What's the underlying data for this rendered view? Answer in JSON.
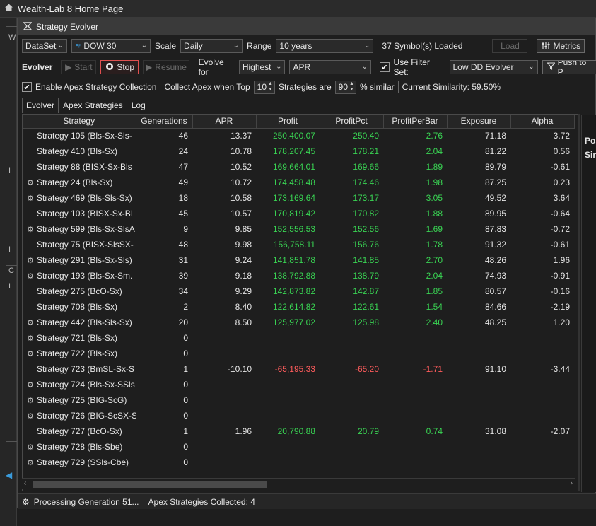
{
  "app": {
    "title": "Wealth-Lab 8 Home Page"
  },
  "window": {
    "title": "Strategy Evolver"
  },
  "toolbar1": {
    "dataset": "DataSet",
    "symbolset": "DOW 30",
    "scale_label": "Scale",
    "scale_value": "Daily",
    "range_label": "Range",
    "range_value": "10 years",
    "symbols_loaded": "37 Symbol(s) Loaded",
    "load": "Load",
    "metrics": "Metrics"
  },
  "toolbar2": {
    "evolver_label": "Evolver",
    "start": "Start",
    "stop": "Stop",
    "resume": "Resume",
    "evolve_for_label": "Evolve for",
    "evolve_direction": "Highest",
    "evolve_metric": "APR",
    "use_filter_label": "Use Filter Set:",
    "filter_set": "Low DD Evolver",
    "push_to": "Push to P"
  },
  "toolbar3": {
    "enable_apex": "Enable Apex Strategy Collection",
    "collect_apex": "Collect Apex when Top",
    "top_value": "10",
    "strategies_are": "Strategies are",
    "similar_value": "90",
    "similar_suffix": "% similar",
    "current_similarity": "Current Similarity: 59.50%"
  },
  "tabs": [
    "Evolver",
    "Apex Strategies",
    "Log"
  ],
  "grid": {
    "headers": [
      "Strategy",
      "Generations",
      "APR",
      "Profit",
      "ProfitPct",
      "ProfitPerBar",
      "Exposure",
      "Alpha"
    ],
    "rows": [
      {
        "busy": false,
        "strategy": "Strategy 105 (Bls-Sx-Sls-",
        "gen": "46",
        "apr": "13.37",
        "profit": "250,400.07",
        "pct": "250.40",
        "ppb": "2.76",
        "exp": "71.18",
        "alpha": "3.72",
        "neg": false
      },
      {
        "busy": false,
        "strategy": "Strategy 410 (Bls-Sx)",
        "gen": "24",
        "apr": "10.78",
        "profit": "178,207.45",
        "pct": "178.21",
        "ppb": "2.04",
        "exp": "81.22",
        "alpha": "0.56",
        "neg": false
      },
      {
        "busy": false,
        "strategy": "Strategy 88 (BISX-Sx-Bls",
        "gen": "47",
        "apr": "10.52",
        "profit": "169,664.01",
        "pct": "169.66",
        "ppb": "1.89",
        "exp": "89.79",
        "alpha": "-0.61",
        "neg": false
      },
      {
        "busy": true,
        "strategy": "Strategy 24 (Bls-Sx)",
        "gen": "49",
        "apr": "10.72",
        "profit": "174,458.48",
        "pct": "174.46",
        "ppb": "1.98",
        "exp": "87.25",
        "alpha": "0.23",
        "neg": false
      },
      {
        "busy": true,
        "strategy": "Strategy 469 (Bls-Sls-Sx)",
        "gen": "18",
        "apr": "10.58",
        "profit": "173,169.64",
        "pct": "173.17",
        "ppb": "3.05",
        "exp": "49.52",
        "alpha": "3.64",
        "neg": false
      },
      {
        "busy": false,
        "strategy": "Strategy 103 (BISX-Sx-BI",
        "gen": "45",
        "apr": "10.57",
        "profit": "170,819.42",
        "pct": "170.82",
        "ppb": "1.88",
        "exp": "89.95",
        "alpha": "-0.64",
        "neg": false
      },
      {
        "busy": true,
        "strategy": "Strategy 599 (Bls-Sx-SlsA",
        "gen": "9",
        "apr": "9.85",
        "profit": "152,556.53",
        "pct": "152.56",
        "ppb": "1.69",
        "exp": "87.83",
        "alpha": "-0.72",
        "neg": false
      },
      {
        "busy": false,
        "strategy": "Strategy 75 (BISX-SlsSX-",
        "gen": "48",
        "apr": "9.98",
        "profit": "156,758.11",
        "pct": "156.76",
        "ppb": "1.78",
        "exp": "91.32",
        "alpha": "-0.61",
        "neg": false
      },
      {
        "busy": true,
        "strategy": "Strategy 291 (Bls-Sx-Sls)",
        "gen": "31",
        "apr": "9.24",
        "profit": "141,851.78",
        "pct": "141.85",
        "ppb": "2.70",
        "exp": "48.26",
        "alpha": "1.96",
        "neg": false
      },
      {
        "busy": true,
        "strategy": "Strategy 193 (Bls-Sx-Sm.",
        "gen": "39",
        "apr": "9.18",
        "profit": "138,792.88",
        "pct": "138.79",
        "ppb": "2.04",
        "exp": "74.93",
        "alpha": "-0.91",
        "neg": false
      },
      {
        "busy": false,
        "strategy": "Strategy 275 (BcO-Sx)",
        "gen": "34",
        "apr": "9.29",
        "profit": "142,873.82",
        "pct": "142.87",
        "ppb": "1.85",
        "exp": "80.57",
        "alpha": "-0.16",
        "neg": false
      },
      {
        "busy": false,
        "strategy": "Strategy 708 (Bls-Sx)",
        "gen": "2",
        "apr": "8.40",
        "profit": "122,614.82",
        "pct": "122.61",
        "ppb": "1.54",
        "exp": "84.66",
        "alpha": "-2.19",
        "neg": false
      },
      {
        "busy": true,
        "strategy": "Strategy 442 (Bls-Sls-Sx)",
        "gen": "20",
        "apr": "8.50",
        "profit": "125,977.02",
        "pct": "125.98",
        "ppb": "2.40",
        "exp": "48.25",
        "alpha": "1.20",
        "neg": false
      },
      {
        "busy": true,
        "strategy": "Strategy 721 (Bls-Sx)",
        "gen": "0",
        "apr": "",
        "profit": "",
        "pct": "",
        "ppb": "",
        "exp": "",
        "alpha": "",
        "neg": false
      },
      {
        "busy": true,
        "strategy": "Strategy 722 (Bls-Sx)",
        "gen": "0",
        "apr": "",
        "profit": "",
        "pct": "",
        "ppb": "",
        "exp": "",
        "alpha": "",
        "neg": false
      },
      {
        "busy": false,
        "strategy": "Strategy 723 (BmSL-Sx-S",
        "gen": "1",
        "apr": "-10.10",
        "profit": "-65,195.33",
        "pct": "-65.20",
        "ppb": "-1.71",
        "exp": "91.10",
        "alpha": "-3.44",
        "neg": true
      },
      {
        "busy": true,
        "strategy": "Strategy 724 (Bls-Sx-SSls",
        "gen": "0",
        "apr": "",
        "profit": "",
        "pct": "",
        "ppb": "",
        "exp": "",
        "alpha": "",
        "neg": false
      },
      {
        "busy": true,
        "strategy": "Strategy 725 (BIG-ScG)",
        "gen": "0",
        "apr": "",
        "profit": "",
        "pct": "",
        "ppb": "",
        "exp": "",
        "alpha": "",
        "neg": false
      },
      {
        "busy": true,
        "strategy": "Strategy 726 (BIG-ScSX-S",
        "gen": "0",
        "apr": "",
        "profit": "",
        "pct": "",
        "ppb": "",
        "exp": "",
        "alpha": "",
        "neg": false
      },
      {
        "busy": false,
        "strategy": "Strategy 727 (BcO-Sx)",
        "gen": "1",
        "apr": "1.96",
        "profit": "20,790.88",
        "pct": "20.79",
        "ppb": "0.74",
        "exp": "31.08",
        "alpha": "-2.07",
        "neg": false
      },
      {
        "busy": true,
        "strategy": "Strategy 728 (Bls-Sbe)",
        "gen": "0",
        "apr": "",
        "profit": "",
        "pct": "",
        "ppb": "",
        "exp": "",
        "alpha": "",
        "neg": false
      },
      {
        "busy": true,
        "strategy": "Strategy 729 (SSls-Cbe)",
        "gen": "0",
        "apr": "",
        "profit": "",
        "pct": "",
        "ppb": "",
        "exp": "",
        "alpha": "",
        "neg": false
      }
    ]
  },
  "status": {
    "processing": "Processing Generation 51...",
    "apex_collected": "Apex Strategies Collected: 4"
  },
  "side_panel": {
    "label1": "Pos",
    "label2": "Sin"
  },
  "colors": {
    "positive": "#39d353",
    "negative": "#ff5c5c",
    "stop_border": "#e05050"
  }
}
